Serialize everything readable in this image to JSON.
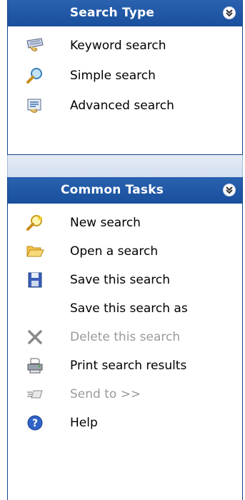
{
  "search_type": {
    "title": "Search Type",
    "items": [
      {
        "label": "Keyword search",
        "icon": "keyboard-icon"
      },
      {
        "label": "Simple search",
        "icon": "magnifier-icon"
      },
      {
        "label": "Advanced search",
        "icon": "advanced-search-icon"
      }
    ]
  },
  "common_tasks": {
    "title": "Common Tasks",
    "items": [
      {
        "label": "New search",
        "icon": "new-search-icon"
      },
      {
        "label": "Open a search",
        "icon": "folder-open-icon"
      },
      {
        "label": "Save this search",
        "icon": "floppy-disk-icon"
      },
      {
        "label": "Save this search as",
        "icon": ""
      },
      {
        "label": "Delete this search",
        "icon": "delete-x-icon",
        "disabled": true
      },
      {
        "label": "Print search results",
        "icon": "printer-icon"
      },
      {
        "label": "Send to >>",
        "icon": "send-to-icon",
        "disabled": true
      },
      {
        "label": "Help",
        "icon": "help-icon"
      }
    ]
  },
  "colors": {
    "header_blue": "#194f9c",
    "border_blue": "#15428b",
    "disabled_text": "#9a9a9a"
  }
}
